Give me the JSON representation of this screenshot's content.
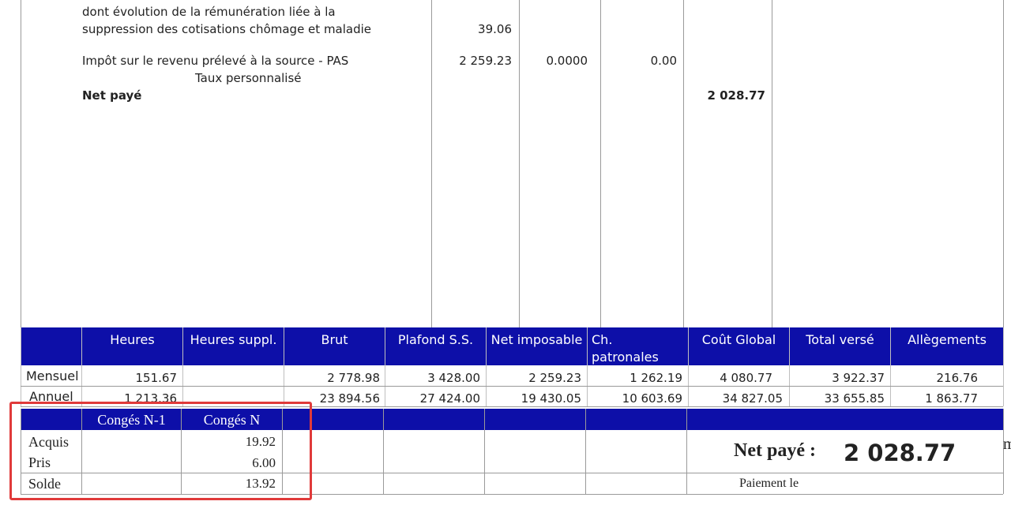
{
  "top": {
    "line1": "dont évolution de la rémunération liée à la",
    "line2": "suppression des cotisations chômage et maladie",
    "line2_value": "39.06",
    "pas_label": "Impôt sur le revenu prélevé à la source - PAS",
    "pas_base": "2 259.23",
    "pas_taux": "0.0000",
    "pas_montant": "0.00",
    "taux_label": "Taux personnalisé",
    "net_label": "Net payé",
    "net_value": "2 028.77"
  },
  "summary": {
    "headers": [
      "Heures",
      "Heures suppl.",
      "Brut",
      "Plafond S.S.",
      "Net imposable",
      "Ch. patronales",
      "Coût Global",
      "Total versé",
      "Allègements"
    ],
    "rows": [
      {
        "label": "Mensuel",
        "values": [
          "151.67",
          "",
          "2 778.98",
          "3 428.00",
          "2 259.23",
          "1 262.19",
          "4 080.77",
          "3 922.37",
          "216.76"
        ]
      },
      {
        "label": "Annuel",
        "values": [
          "1 213.36",
          "",
          "23 894.56",
          "27 424.00",
          "19 430.05",
          "10 603.69",
          "34 827.05",
          "33 655.85",
          "1 863.77"
        ]
      }
    ]
  },
  "conges": {
    "headers": [
      "Congés N-1",
      "Congés N"
    ],
    "rows": [
      {
        "label": "Acquis",
        "n1": "",
        "n": "19.92"
      },
      {
        "label": "Pris",
        "n1": "",
        "n": "6.00"
      },
      {
        "label": "Solde",
        "n1": "",
        "n": "13.92"
      }
    ]
  },
  "footer": {
    "net_label": "Net payé :",
    "net_value": "2 028.77",
    "paiement_label": "Paiement le"
  },
  "colors": {
    "header_blue": "#0d0fa8",
    "highlight_red": "#e03a3a"
  }
}
